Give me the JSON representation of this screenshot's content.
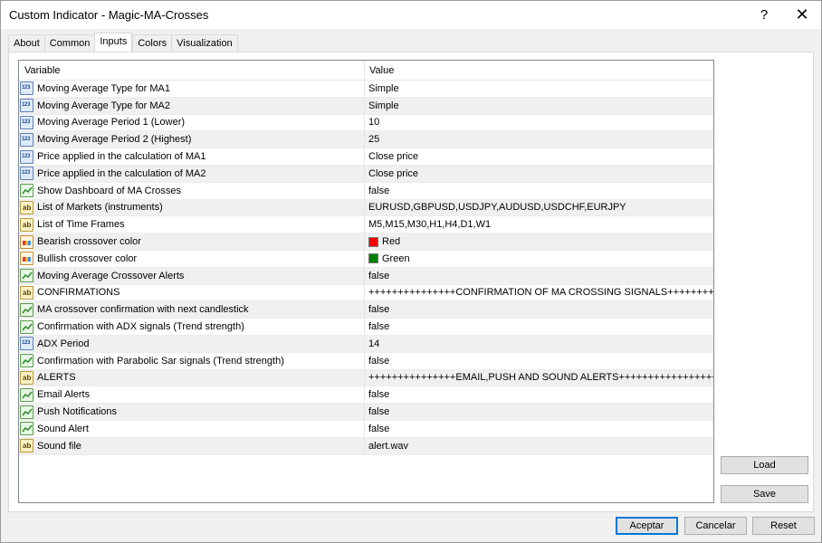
{
  "window": {
    "title": "Custom Indicator - Magic-MA-Crosses",
    "help_label": "?",
    "close_label": "✕"
  },
  "tabs": [
    {
      "label": "About"
    },
    {
      "label": "Common"
    },
    {
      "label": "Inputs",
      "active": true
    },
    {
      "label": "Colors"
    },
    {
      "label": "Visualization"
    }
  ],
  "grid": {
    "header_variable": "Variable",
    "header_value": "Value",
    "rows": [
      {
        "icon": "number-icon",
        "variable": "Moving Average Type for MA1",
        "value": "Simple"
      },
      {
        "icon": "number-icon",
        "variable": "Moving Average Type for MA2",
        "value": "Simple"
      },
      {
        "icon": "number-icon",
        "variable": "Moving Average Period 1 (Lower)",
        "value": "10"
      },
      {
        "icon": "number-icon",
        "variable": "Moving Average Period 2 (Highest)",
        "value": "25"
      },
      {
        "icon": "number-icon",
        "variable": "Price applied in the calculation of MA1",
        "value": "Close price"
      },
      {
        "icon": "number-icon",
        "variable": "Price applied in the calculation of MA2",
        "value": "Close price"
      },
      {
        "icon": "boolean-icon",
        "variable": "Show Dashboard of MA Crosses",
        "value": "false"
      },
      {
        "icon": "string-icon",
        "variable": "List of Markets (instruments)",
        "value": "EURUSD,GBPUSD,USDJPY,AUDUSD,USDCHF,EURJPY"
      },
      {
        "icon": "string-icon",
        "variable": "List of Time Frames",
        "value": "M5,M15,M30,H1,H4,D1,W1"
      },
      {
        "icon": "color-icon",
        "variable": "Bearish crossover color",
        "value": "Red",
        "swatch": "#ff0000"
      },
      {
        "icon": "color-icon",
        "variable": "Bullish crossover color",
        "value": "Green",
        "swatch": "#008000"
      },
      {
        "icon": "boolean-icon",
        "variable": "Moving Average Crossover Alerts",
        "value": "false"
      },
      {
        "icon": "string-icon",
        "variable": "CONFIRMATIONS",
        "value": "+++++++++++++++CONFIRMATION OF MA CROSSING SIGNALS++++++++++++..."
      },
      {
        "icon": "boolean-icon",
        "variable": "MA crossover confirmation with next candlestick",
        "value": "false"
      },
      {
        "icon": "boolean-icon",
        "variable": "Confirmation with ADX signals (Trend strength)",
        "value": "false"
      },
      {
        "icon": "number-icon",
        "variable": "ADX Period",
        "value": "14"
      },
      {
        "icon": "boolean-icon",
        "variable": "Confirmation with Parabolic Sar signals (Trend strength)",
        "value": "false"
      },
      {
        "icon": "string-icon",
        "variable": "ALERTS",
        "value": "+++++++++++++++EMAIL,PUSH AND SOUND ALERTS+++++++++++++++++"
      },
      {
        "icon": "boolean-icon",
        "variable": "Email Alerts",
        "value": "false"
      },
      {
        "icon": "boolean-icon",
        "variable": "Push Notifications",
        "value": "false"
      },
      {
        "icon": "boolean-icon",
        "variable": "Sound Alert",
        "value": "false"
      },
      {
        "icon": "string-icon",
        "variable": "Sound file",
        "value": "alert.wav"
      }
    ]
  },
  "side_buttons": {
    "load": "Load",
    "save": "Save"
  },
  "footer": {
    "ok": "Aceptar",
    "cancel": "Cancelar",
    "reset": "Reset"
  }
}
